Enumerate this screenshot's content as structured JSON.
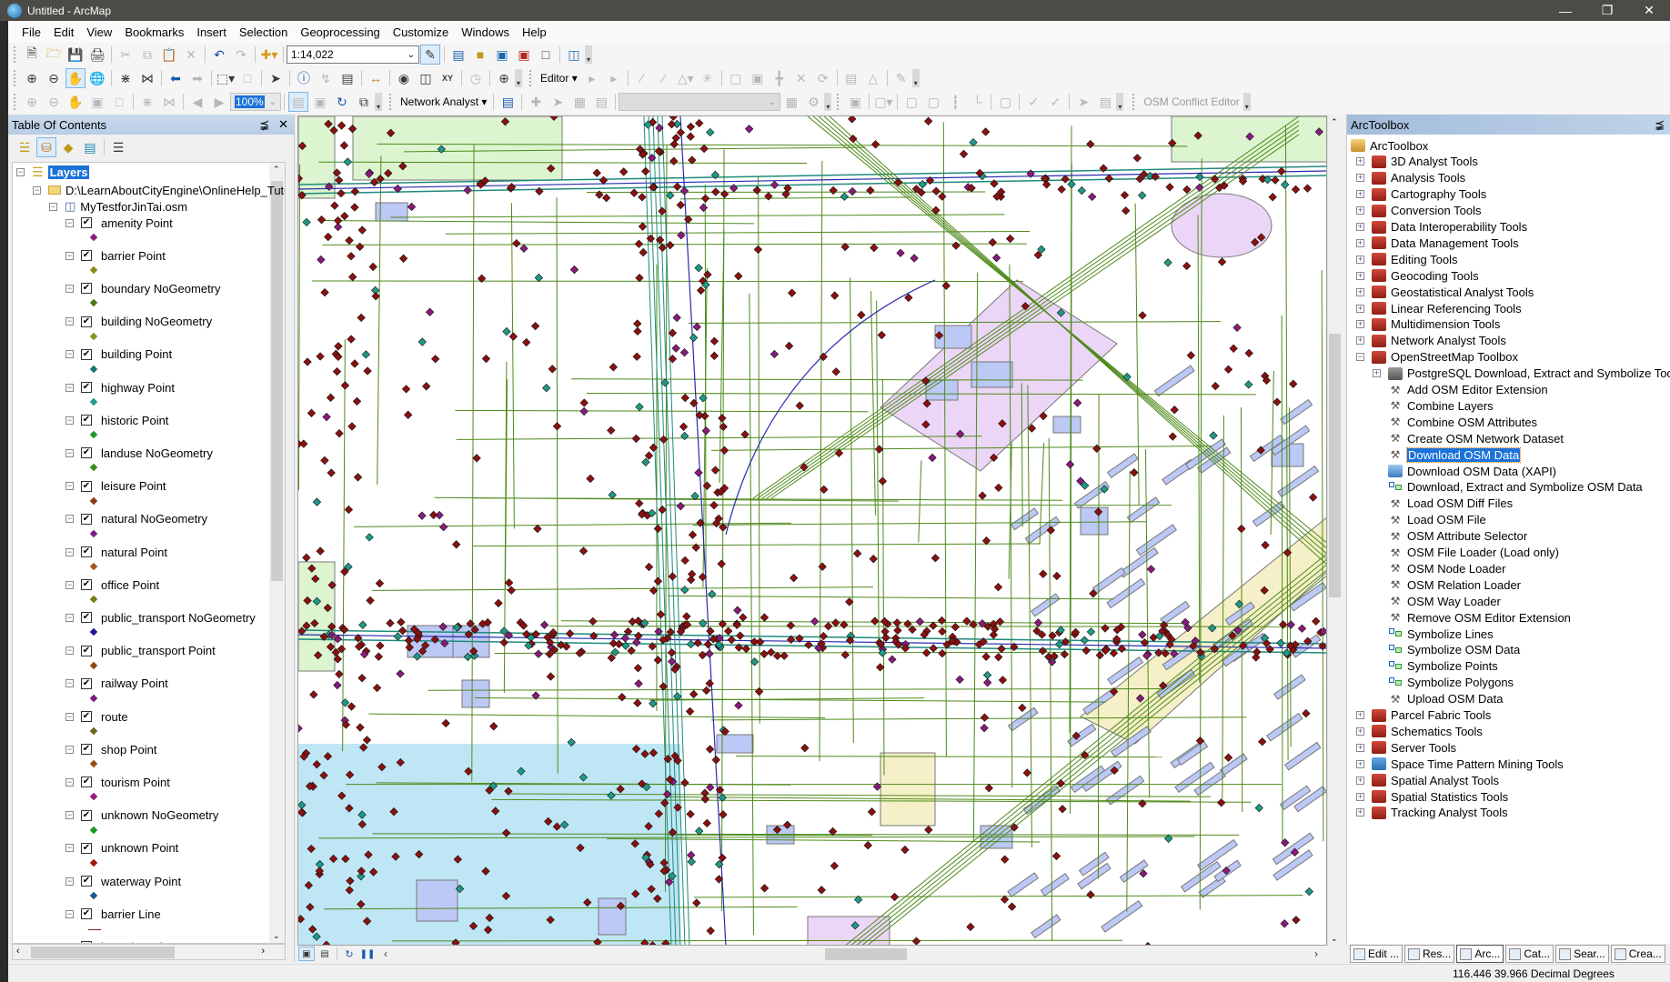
{
  "window": {
    "title": "Untitled - ArcMap",
    "controls": [
      "minimize",
      "restore",
      "close"
    ]
  },
  "menu": [
    "File",
    "Edit",
    "View",
    "Bookmarks",
    "Insert",
    "Selection",
    "Geoprocessing",
    "Customize",
    "Windows",
    "Help"
  ],
  "toolbars": {
    "standard": {
      "scale": "1:14,022"
    },
    "tools": {
      "editor_label": "Editor"
    },
    "layout": {
      "zoom_percent": "100%"
    },
    "network_analyst": {
      "label": "Network Analyst"
    },
    "osm": {
      "label": "OSM Conflict Editor"
    }
  },
  "toc": {
    "title": "Table Of Contents",
    "root": "Layers",
    "folder": "D:\\LearnAboutCityEngine\\OnlineHelp_Tuto",
    "dataset": "MyTestforJinTai.osm",
    "layers": [
      {
        "name": "amenity Point",
        "checked": true,
        "symbol_color": "#8b1a7d",
        "symbol": "point"
      },
      {
        "name": "barrier Point",
        "checked": true,
        "symbol_color": "#8c8c1a",
        "symbol": "point"
      },
      {
        "name": "boundary NoGeometry",
        "checked": true,
        "symbol_color": "#4f7a14",
        "symbol": "point"
      },
      {
        "name": "building NoGeometry",
        "checked": true,
        "symbol_color": "#7c9a1a",
        "symbol": "point"
      },
      {
        "name": "building Point",
        "checked": true,
        "symbol_color": "#167a6c",
        "symbol": "point"
      },
      {
        "name": "highway Point",
        "checked": true,
        "symbol_color": "#1f9a86",
        "symbol": "point"
      },
      {
        "name": "historic Point",
        "checked": true,
        "symbol_color": "#1a9a2a",
        "symbol": "point"
      },
      {
        "name": "landuse NoGeometry",
        "checked": true,
        "symbol_color": "#3a8a1a",
        "symbol": "point"
      },
      {
        "name": "leisure Point",
        "checked": true,
        "symbol_color": "#8a3a10",
        "symbol": "point"
      },
      {
        "name": "natural NoGeometry",
        "checked": true,
        "symbol_color": "#7a1a8a",
        "symbol": "point"
      },
      {
        "name": "natural Point",
        "checked": true,
        "symbol_color": "#a8581a",
        "symbol": "point"
      },
      {
        "name": "office Point",
        "checked": true,
        "symbol_color": "#7a7a1a",
        "symbol": "point"
      },
      {
        "name": "public_transport NoGeometry",
        "checked": true,
        "symbol_color": "#1a1a9a",
        "symbol": "point"
      },
      {
        "name": "public_transport Point",
        "checked": true,
        "symbol_color": "#8a4a10",
        "symbol": "point"
      },
      {
        "name": "railway Point",
        "checked": true,
        "symbol_color": "#7a1a7a",
        "symbol": "point"
      },
      {
        "name": "route",
        "checked": true,
        "symbol_color": "#6a6a1a",
        "symbol": "point"
      },
      {
        "name": "shop Point",
        "checked": true,
        "symbol_color": "#9a4a10",
        "symbol": "point"
      },
      {
        "name": "tourism Point",
        "checked": true,
        "symbol_color": "#9a1a7a",
        "symbol": "point"
      },
      {
        "name": "unknown NoGeometry",
        "checked": true,
        "symbol_color": "#1a9a1a",
        "symbol": "point"
      },
      {
        "name": "unknown Point",
        "checked": true,
        "symbol_color": "#9a1a10",
        "symbol": "point"
      },
      {
        "name": "waterway Point",
        "checked": true,
        "symbol_color": "#1a5a8a",
        "symbol": "point"
      },
      {
        "name": "barrier Line",
        "checked": true,
        "symbol_color": "#8a1a1a",
        "symbol": "line"
      },
      {
        "name": "boundary Line",
        "checked": true,
        "symbol_color": "#4f7a14",
        "symbol": "line"
      }
    ]
  },
  "map": {
    "colors": {
      "node": "#8b1010",
      "road": "#4e8a1a",
      "highway": "#1f8a7a",
      "rail": "#2a2ab0",
      "building": "#bcc8f5",
      "park": "#dcf5d0",
      "water": "#bfe6f5",
      "landuse": "#ecd6f7",
      "sand": "#f5f0c8"
    }
  },
  "toolbox": {
    "title": "ArcToolbox",
    "root": "ArcToolbox",
    "toolboxes_before": [
      "3D Analyst Tools",
      "Analysis Tools",
      "Cartography Tools",
      "Conversion Tools",
      "Data Interoperability Tools",
      "Data Management Tools",
      "Editing Tools",
      "Geocoding Tools",
      "Geostatistical Analyst Tools",
      "Linear Referencing Tools",
      "Multidimension Tools",
      "Network Analyst Tools"
    ],
    "expanded": "OpenStreetMap Toolbox",
    "expanded_children": [
      {
        "label": "PostgreSQL Download, Extract and Symbolize Tools",
        "type": "toolset"
      },
      {
        "label": "Add OSM Editor Extension",
        "type": "tool"
      },
      {
        "label": "Combine Layers",
        "type": "tool"
      },
      {
        "label": "Combine OSM Attributes",
        "type": "tool"
      },
      {
        "label": "Create OSM Network Dataset",
        "type": "tool"
      },
      {
        "label": "Download OSM Data",
        "type": "tool",
        "selected": true
      },
      {
        "label": "Download OSM Data (XAPI)",
        "type": "script"
      },
      {
        "label": "Download, Extract and Symbolize OSM Data",
        "type": "model"
      },
      {
        "label": "Load OSM Diff Files",
        "type": "tool"
      },
      {
        "label": "Load OSM File",
        "type": "tool"
      },
      {
        "label": "OSM Attribute Selector",
        "type": "tool"
      },
      {
        "label": "OSM File Loader (Load only)",
        "type": "tool"
      },
      {
        "label": "OSM Node Loader",
        "type": "tool"
      },
      {
        "label": "OSM Relation Loader",
        "type": "tool"
      },
      {
        "label": "OSM Way Loader",
        "type": "tool"
      },
      {
        "label": "Remove OSM Editor Extension",
        "type": "tool"
      },
      {
        "label": "Symbolize Lines",
        "type": "model"
      },
      {
        "label": "Symbolize OSM Data",
        "type": "model"
      },
      {
        "label": "Symbolize Points",
        "type": "model"
      },
      {
        "label": "Symbolize Polygons",
        "type": "model"
      },
      {
        "label": "Upload OSM Data",
        "type": "tool"
      }
    ],
    "toolboxes_after": [
      "Parcel Fabric Tools",
      "Schematics Tools",
      "Server Tools",
      "Space Time Pattern Mining Tools",
      "Spatial Analyst Tools",
      "Spatial Statistics Tools",
      "Tracking Analyst Tools"
    ]
  },
  "dock_tabs": [
    "Edit ...",
    "Res...",
    "Arc...",
    "Cat...",
    "Sear...",
    "Crea..."
  ],
  "dock_active": 2,
  "status": {
    "coordinates": "116.446  39.966 Decimal Degrees"
  }
}
